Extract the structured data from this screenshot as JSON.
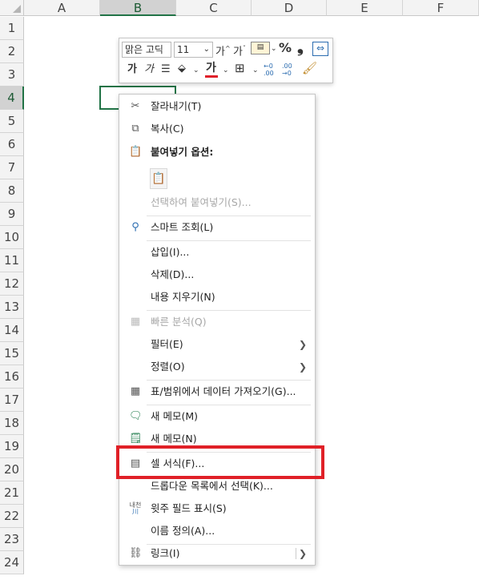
{
  "columns": [
    "A",
    "B",
    "C",
    "D",
    "E",
    "F"
  ],
  "rows": [
    "1",
    "2",
    "3",
    "4",
    "5",
    "6",
    "7",
    "8",
    "9",
    "10",
    "11",
    "12",
    "13",
    "14",
    "15",
    "16",
    "17",
    "18",
    "19",
    "20",
    "21",
    "22",
    "23",
    "24"
  ],
  "selected_column": "B",
  "selected_row": "4",
  "mini_toolbar": {
    "font_name": "맑은 고딕",
    "font_size": "11",
    "grow_font": "가",
    "shrink_font": "가",
    "bold": "가",
    "italic": "가",
    "font_color": "가",
    "percent": "%",
    "comma": "❟",
    "dec_increase": ".00",
    "dec_decrease": ".00"
  },
  "context_menu": {
    "cut": "잘라내기(T)",
    "copy": "복사(C)",
    "paste_options": "붙여넣기 옵션:",
    "paste_special": "선택하여 붙여넣기(S)...",
    "smart_lookup": "스마트 조회(L)",
    "insert": "삽입(I)...",
    "delete": "삭제(D)...",
    "clear_contents": "내용 지우기(N)",
    "quick_analysis": "빠른 분석(Q)",
    "filter": "필터(E)",
    "sort": "정렬(O)",
    "table_range": "표/범위에서 데이터 가져오기(G)...",
    "new_comment": "새 메모(M)",
    "new_note": "새 메모(N)",
    "format_cells": "셀 서식(F)...",
    "pick_dropdown": "드롭다운 목록에서 선택(K)...",
    "phonetic": "윗주 필드 표시(S)",
    "define_name": "이름 정의(A)...",
    "link": "링크(I)",
    "phonetic_icon_text": "내천"
  },
  "colors": {
    "accent_green": "#217346",
    "highlight_red": "#e02027",
    "font_color_bar": "#e0202a"
  }
}
